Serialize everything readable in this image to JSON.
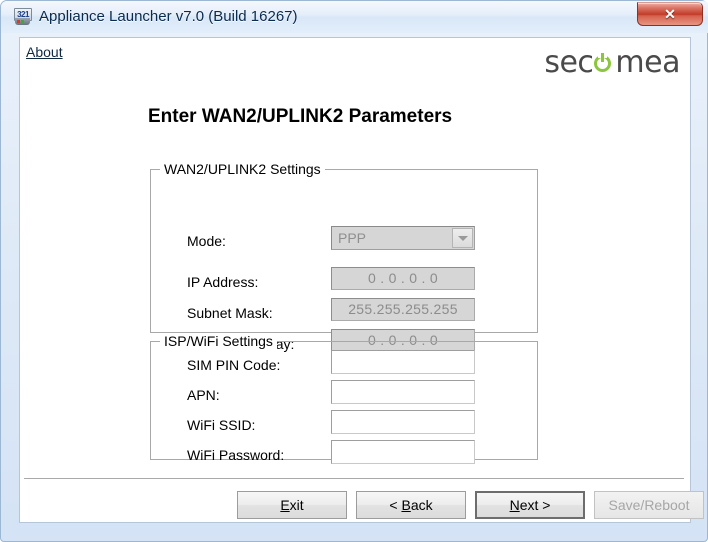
{
  "window": {
    "title": "Appliance Launcher v7.0 (Build 16267)",
    "app_icon": "app-321-icon",
    "close_label": "✕"
  },
  "header": {
    "about_label": "About",
    "logo_text_left": "sec",
    "logo_text_right": "mea",
    "logo_accent_color": "#8cc63f"
  },
  "page": {
    "title": "Enter WAN2/UPLINK2 Parameters"
  },
  "wan_group": {
    "title": "WAN2/UPLINK2 Settings",
    "fields": [
      {
        "label": "Mode:",
        "value": "PPP",
        "type": "combobox",
        "enabled": false
      },
      {
        "label": "IP Address:",
        "value": "0 . 0 . 0 . 0",
        "type": "ip",
        "enabled": false
      },
      {
        "label": "Subnet Mask:",
        "value": "255.255.255.255",
        "type": "ip",
        "enabled": false
      },
      {
        "label": "Default Gateway:",
        "value": "0 . 0 . 0 . 0",
        "type": "ip",
        "enabled": false
      }
    ]
  },
  "isp_group": {
    "title": "ISP/WiFi Settings",
    "fields": [
      {
        "label": "SIM PIN Code:",
        "value": "",
        "placeholder": "",
        "enabled": true
      },
      {
        "label": "APN:",
        "value": "",
        "placeholder": "",
        "enabled": true
      },
      {
        "label": "WiFi SSID:",
        "value": "",
        "placeholder": "",
        "enabled": true
      },
      {
        "label": "WiFi Password:",
        "value": "",
        "placeholder": "",
        "enabled": true
      }
    ]
  },
  "footer": {
    "buttons": [
      {
        "name": "exit",
        "prefix": "",
        "mnemonic": "E",
        "suffix": "xit",
        "state": "normal"
      },
      {
        "name": "back",
        "prefix": "< ",
        "mnemonic": "B",
        "suffix": "ack",
        "state": "normal"
      },
      {
        "name": "next",
        "prefix": "",
        "mnemonic": "N",
        "suffix": "ext >",
        "state": "default"
      },
      {
        "name": "save-reboot",
        "prefix": "",
        "mnemonic": "",
        "suffix": "Save/Reboot",
        "state": "disabled"
      }
    ]
  }
}
